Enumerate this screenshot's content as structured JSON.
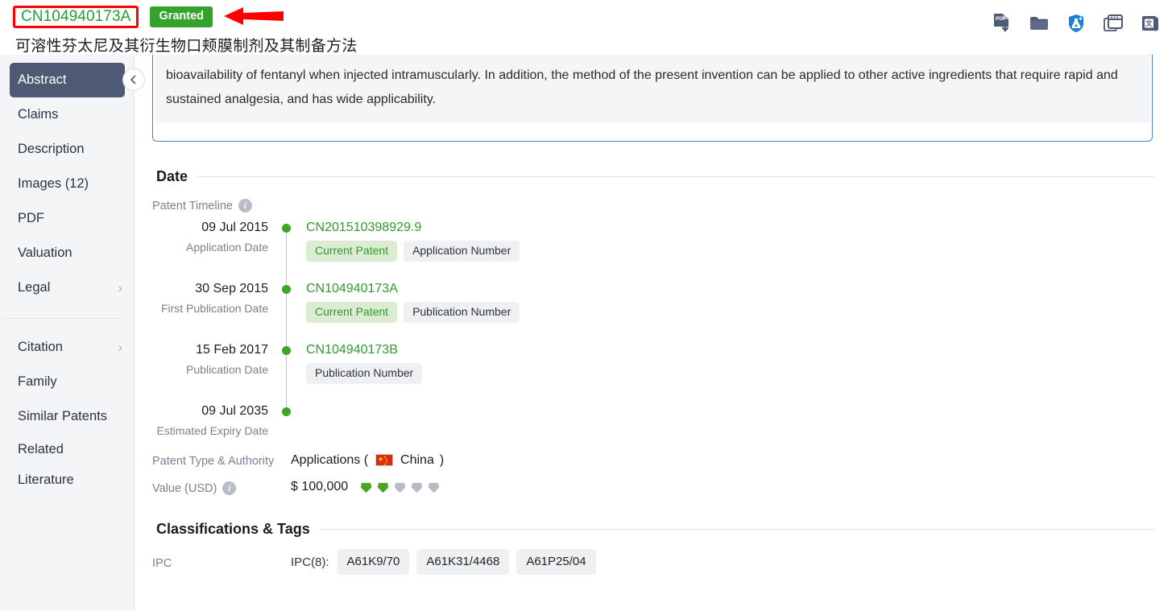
{
  "header": {
    "patent_number": "CN104940173A",
    "status_badge": "Granted",
    "title_cn": "可溶性芬太尼及其衍生物口颊膜制剂及其制备方法",
    "icons": [
      {
        "name": "pdf-download-icon",
        "label": "PDF"
      },
      {
        "name": "folder-icon",
        "label": "Folder"
      },
      {
        "name": "chemistry-shield-icon",
        "label": "Chemistry"
      },
      {
        "name": "browser-window-icon",
        "label": "Window"
      },
      {
        "name": "translate-icon",
        "label": "Translate"
      }
    ],
    "annotation": "red-left-arrow"
  },
  "sidebar": {
    "items": [
      {
        "label": "Abstract",
        "active": true,
        "chevron": false
      },
      {
        "label": "Claims",
        "active": false,
        "chevron": false
      },
      {
        "label": "Description",
        "active": false,
        "chevron": false
      },
      {
        "label": "Images (12)",
        "active": false,
        "chevron": false
      },
      {
        "label": "PDF",
        "active": false,
        "chevron": false
      },
      {
        "label": "Valuation",
        "active": false,
        "chevron": false
      },
      {
        "label": "Legal",
        "active": false,
        "chevron": true
      }
    ],
    "items2": [
      {
        "label": "Citation",
        "active": false,
        "chevron": true
      },
      {
        "label": "Family",
        "active": false,
        "chevron": false
      },
      {
        "label": "Similar Patents",
        "active": false,
        "chevron": false
      },
      {
        "label": "Related",
        "active": false,
        "chevron": false
      },
      {
        "label": "Literature",
        "active": false,
        "chevron": false
      }
    ],
    "collapse_glyph": "‹"
  },
  "abstract": {
    "text": "bioavailability of fentanyl when injected intramuscularly. In addition, the method of the present invention can be applied to other active ingredients that require rapid and sustained analgesia, and has wide applicability."
  },
  "date_section": {
    "title": "Date",
    "timeline_label": "Patent Timeline",
    "entries": [
      {
        "date": "09 Jul 2015",
        "date_label": "Application Date",
        "doc_number": "CN201510398929.9",
        "tags": [
          {
            "text": "Current Patent",
            "style": "green"
          },
          {
            "text": "Application Number",
            "style": "grey"
          }
        ]
      },
      {
        "date": "30 Sep 2015",
        "date_label": "First Publication Date",
        "doc_number": "CN104940173A",
        "tags": [
          {
            "text": "Current Patent",
            "style": "green"
          },
          {
            "text": "Publication Number",
            "style": "grey"
          }
        ]
      },
      {
        "date": "15 Feb 2017",
        "date_label": "Publication Date",
        "doc_number": "CN104940173B",
        "tags": [
          {
            "text": "Publication Number",
            "style": "grey"
          }
        ]
      },
      {
        "date": "09 Jul 2035",
        "date_label": "Estimated Expiry Date",
        "doc_number": "",
        "tags": []
      }
    ],
    "patent_type_label": "Patent Type & Authority",
    "patent_type_value_pre": "Applications (",
    "patent_type_country": "China",
    "patent_type_value_post": ")",
    "value_label": "Value (USD)",
    "value_amount": "$ 100,000",
    "value_rating": 2,
    "value_rating_max": 5
  },
  "classifications": {
    "title": "Classifications & Tags",
    "ipc_label": "IPC",
    "ipc_prefix": "IPC(8):",
    "ipc_codes": [
      "A61K9/70",
      "A61K31/4468",
      "A61P25/04"
    ]
  },
  "colors": {
    "accent_green": "#2e9b2a",
    "granted_green": "#35a22e",
    "annotation_red": "#ff0000",
    "sidebar_active": "#4e5a74",
    "card_border_blue": "#4a7fd4",
    "gem_on": "#4ca420",
    "gem_off": "#b7bcc4"
  }
}
